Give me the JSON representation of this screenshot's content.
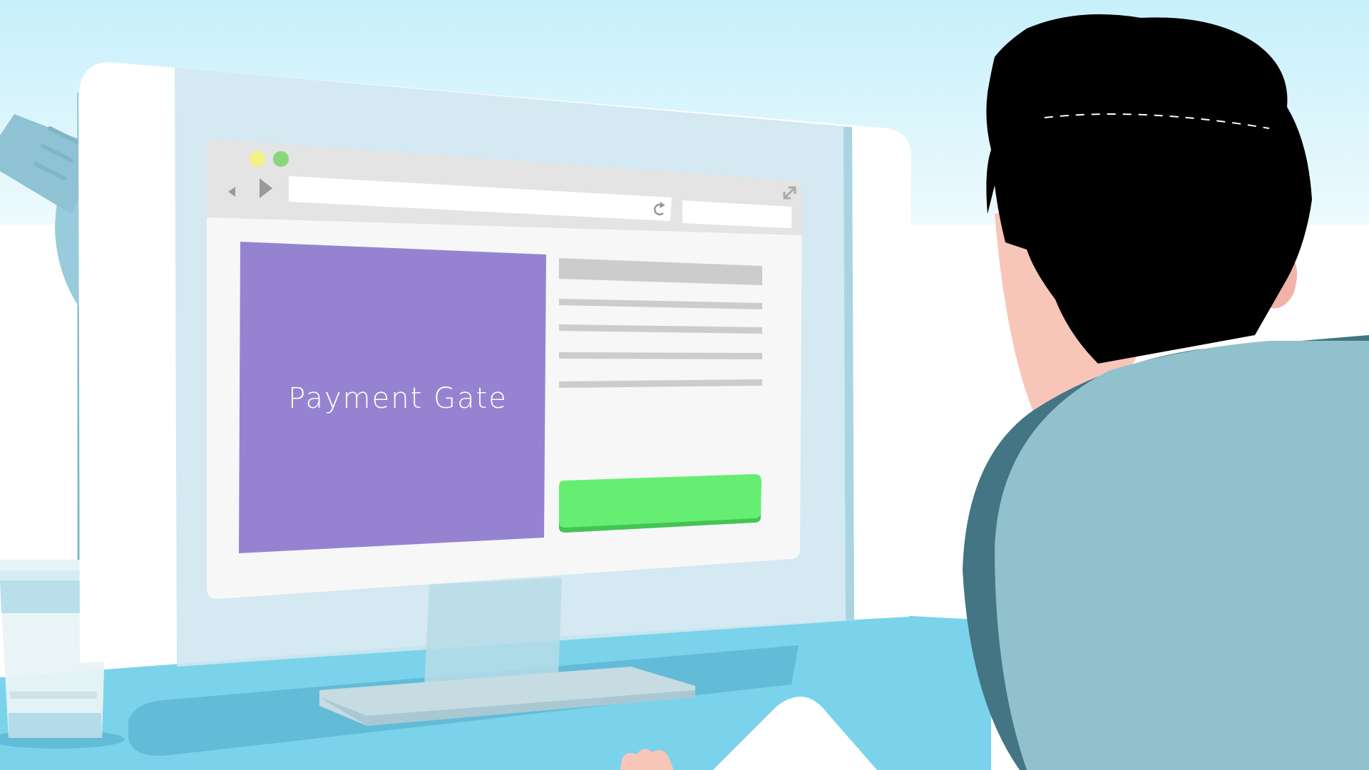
{
  "banner": {
    "text": "Payment Gate"
  },
  "colors": {
    "sky": "#c9f1fb",
    "wall": "#ffffff",
    "desk": "#7ad3ea",
    "desk_shadow": "#62bcd8",
    "monitor_glass": "#cfe7ef",
    "browser_bar": "#e4e4e4",
    "browser_page": "#f7f7f7",
    "banner": "#9583d1",
    "button": "#66ee73",
    "button_shadow": "#45c455",
    "placeholder_lines": "#cccccc",
    "lamp": "#99ccdb",
    "hair": "#000000",
    "skin": "#f7c6b9",
    "sweater": "#92c1ce",
    "sweater_shadow": "#437585",
    "dot_yellow": "#f2f285",
    "dot_green": "#8ad67a"
  },
  "icons": {
    "back": "triangle-left-icon",
    "forward": "triangle-right-icon",
    "reload": "reload-icon",
    "expand": "expand-icon"
  }
}
